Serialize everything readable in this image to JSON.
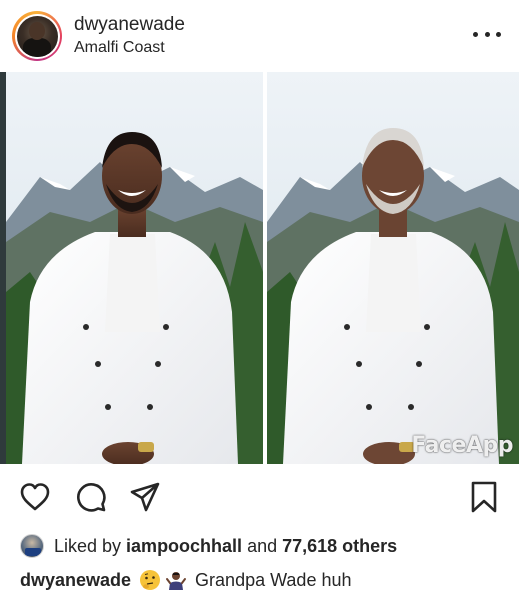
{
  "post": {
    "username": "dwyanewade",
    "location": "Amalfi Coast",
    "more_label": "More options"
  },
  "photo": {
    "watermark": "FaceApp"
  },
  "likes": {
    "prefix": "Liked by ",
    "user": "iampoochhall",
    "middle": " and ",
    "count": "77,618 others"
  },
  "caption": {
    "username": "dwyanewade",
    "emoji_1": "🤔",
    "emoji_2": "🤷🏾‍♂️",
    "text": "Grandpa Wade huh"
  },
  "icons": {
    "like": "heart-icon",
    "comment": "comment-icon",
    "share": "paper-plane-icon",
    "save": "bookmark-icon",
    "more": "more-dots-icon"
  },
  "colors": {
    "text": "#262626",
    "background": "#ffffff",
    "story_ring": [
      "#f9b23a",
      "#e4405f",
      "#c13584"
    ]
  }
}
